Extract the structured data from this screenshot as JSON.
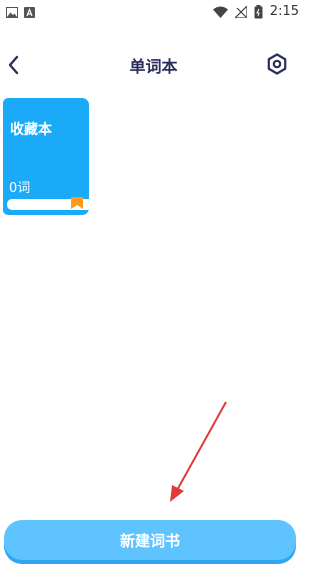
{
  "status_bar": {
    "time": "2:15",
    "icons": [
      "image-icon",
      "a-notification-icon",
      "wifi-icon",
      "no-signal-icon",
      "battery-icon"
    ]
  },
  "header": {
    "title": "单词本",
    "back_icon": "chevron-left-icon",
    "settings_icon": "gear-icon"
  },
  "books": [
    {
      "name": "收藏本",
      "count": "0词"
    }
  ],
  "footer": {
    "new_book_label": "新建词书"
  },
  "colors": {
    "accent": "#1aaaf8",
    "button": "#5ec3ff",
    "title_text": "#2b2d5c",
    "bookmark": "#ff9a1a",
    "annotation_arrow": "#e03b3b"
  }
}
